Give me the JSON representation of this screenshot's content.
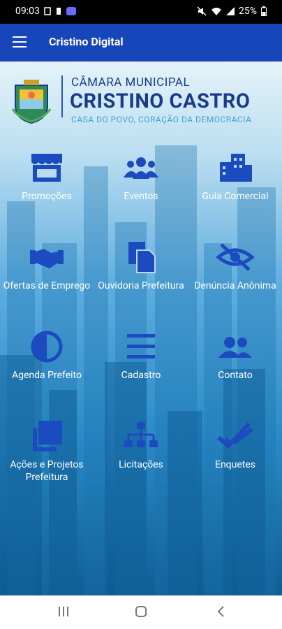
{
  "status": {
    "time": "09:03",
    "battery": "25%"
  },
  "appbar": {
    "title": "Cristino Digital"
  },
  "header": {
    "line1": "CÂMARA MUNICIPAL",
    "line2": "CRISTINO CASTRO",
    "line3": "CASA DO POVO, CORAÇÃO DA DEMOCRACIA"
  },
  "tiles": [
    {
      "label": "Promoções",
      "icon": "store-icon"
    },
    {
      "label": "Eventos",
      "icon": "group-icon"
    },
    {
      "label": "Guia Comercial",
      "icon": "buildings-icon"
    },
    {
      "label": "Ofertas de Emprego",
      "icon": "handshake-icon"
    },
    {
      "label": "Ouvidoria Prefeitura",
      "icon": "documents-icon"
    },
    {
      "label": "Denúncia Anônima",
      "icon": "eye-slash-icon"
    },
    {
      "label": "Agenda Prefeito",
      "icon": "half-circle-icon"
    },
    {
      "label": "Cadastro",
      "icon": "list-lines-icon"
    },
    {
      "label": "Contato",
      "icon": "contacts-icon"
    },
    {
      "label": "Ações e Projetos Prefeitura",
      "icon": "layers-icon"
    },
    {
      "label": "Licitações",
      "icon": "sitemap-icon"
    },
    {
      "label": "Enquetes",
      "icon": "double-check-icon"
    }
  ]
}
